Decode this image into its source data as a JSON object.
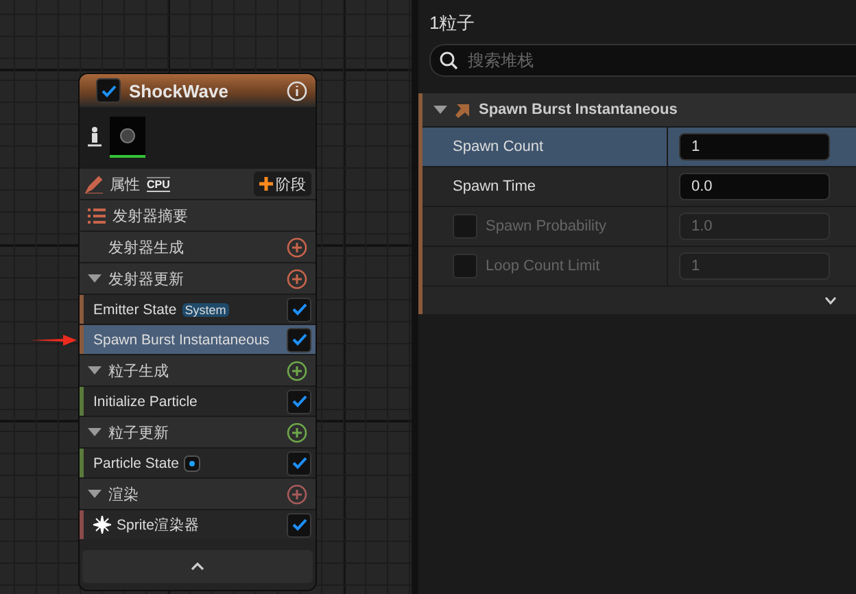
{
  "node": {
    "title": "ShockWave",
    "enabled": true,
    "toolbar": {
      "label": "属性",
      "badge": "CPU",
      "add_button": "阶段"
    },
    "stack": [
      {
        "kind": "summary",
        "label": "发射器摘要"
      },
      {
        "kind": "category",
        "label": "发射器生成",
        "color": "#c8644b"
      },
      {
        "kind": "category",
        "label": "发射器更新",
        "color": "#c8644b",
        "children": [
          {
            "kind": "tagged",
            "label": "Emitter State",
            "tag": "System",
            "checked": true,
            "selected": false,
            "color": "#8a5a3c"
          },
          {
            "kind": "plain",
            "label": "Spawn Burst Instantaneous",
            "checked": true,
            "selected": true,
            "color": "#8a5a3c"
          }
        ]
      },
      {
        "kind": "category",
        "label": "粒子生成",
        "color": "#6ea84a",
        "children": [
          {
            "kind": "plain",
            "label": "Initialize Particle",
            "checked": true,
            "selected": false,
            "color": "#5a7a3c"
          }
        ]
      },
      {
        "kind": "category",
        "label": "粒子更新",
        "color": "#6ea84a",
        "children": [
          {
            "kind": "dot",
            "label": "Particle State",
            "checked": true,
            "selected": false,
            "color": "#5a7a3c"
          }
        ]
      },
      {
        "kind": "category",
        "label": "渲染",
        "color": "#a85a5a",
        "children": [
          {
            "kind": "sprite",
            "label": "Sprite渲染器",
            "checked": true,
            "selected": false,
            "color": "#8a4a4a"
          }
        ]
      }
    ]
  },
  "details": {
    "count": "1粒子",
    "search": {
      "placeholder": "搜索堆栈"
    },
    "section": {
      "title": "Spawn Burst Instantaneous",
      "expanded": true,
      "rows": [
        {
          "label": "Spawn Count",
          "value": "1",
          "selected": true,
          "disabled": false
        },
        {
          "label": "Spawn Time",
          "value": "0.0",
          "selected": false,
          "disabled": false
        },
        {
          "label": "Spawn Probability",
          "value": "1.0",
          "selected": false,
          "disabled": true,
          "checked": false
        },
        {
          "label": "Loop Count Limit",
          "value": "1",
          "selected": false,
          "disabled": true,
          "checked": false
        }
      ]
    }
  }
}
